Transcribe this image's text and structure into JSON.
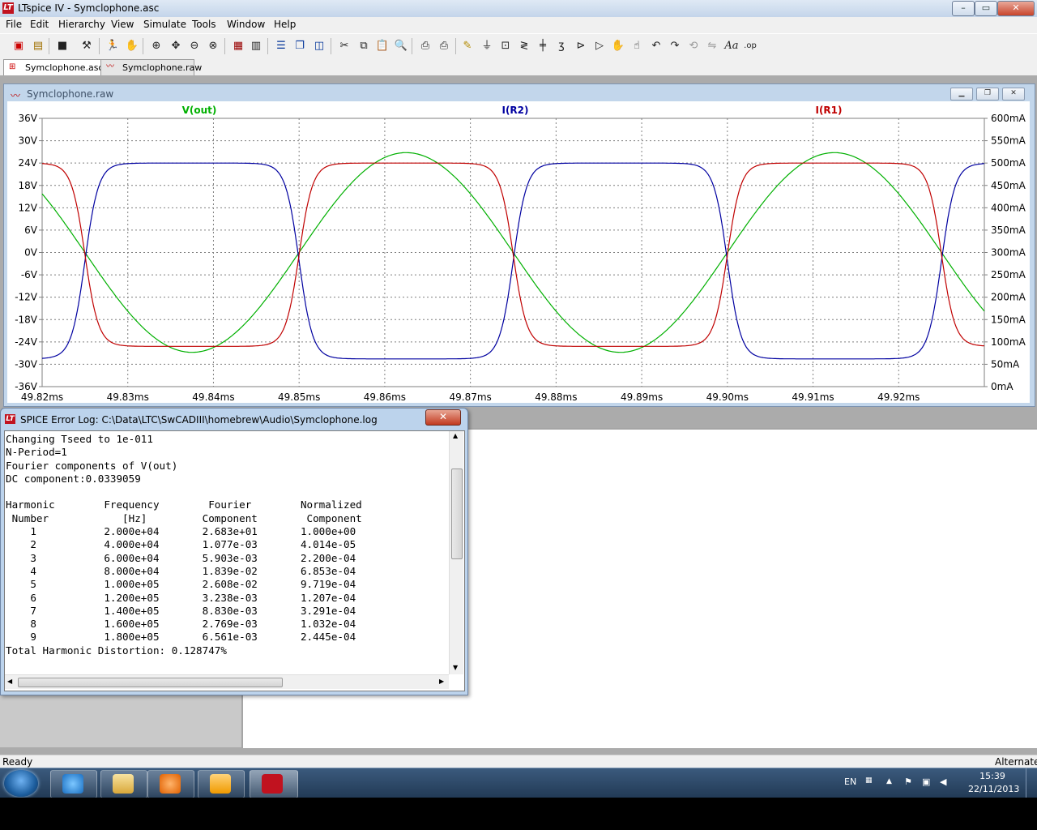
{
  "window": {
    "title": "LTspice IV - Symclophone.asc",
    "app_icon": "LT"
  },
  "menu": [
    "File",
    "Edit",
    "Hierarchy",
    "View",
    "Simulate",
    "Tools",
    "Window",
    "Help"
  ],
  "tabs": [
    {
      "label": "Symclophone.asc",
      "icon": "schematic-icon"
    },
    {
      "label": "Symclophone.raw",
      "icon": "waveform-icon"
    }
  ],
  "plot_window": {
    "title": "Symclophone.raw"
  },
  "chart_data": {
    "type": "line",
    "series": [
      {
        "name": "V(out)",
        "color": "#00b000",
        "axis": "left",
        "amplitude_V": 26.8,
        "phase_peak_ms": 49.8625,
        "shape": "sine"
      },
      {
        "name": "I(R2)",
        "color": "#0000a0",
        "axis": "right",
        "high_mA": 500,
        "low_mA": 62,
        "shape": "clipped-square",
        "high_centers_ms": [
          49.8375,
          49.8875,
          49.9375
        ],
        "low_centers_ms": [
          49.8125,
          49.8625,
          49.9125
        ]
      },
      {
        "name": "I(R1)",
        "color": "#c00000",
        "axis": "right",
        "high_mA": 500,
        "low_mA": 90,
        "shape": "clipped-square",
        "high_centers_ms": [
          49.8125,
          49.8625,
          49.9125
        ],
        "low_centers_ms": [
          49.8375,
          49.8875
        ]
      }
    ],
    "xlim": [
      49.82,
      49.93
    ],
    "x_ticks": [
      "49.82ms",
      "49.83ms",
      "49.84ms",
      "49.85ms",
      "49.86ms",
      "49.87ms",
      "49.88ms",
      "49.89ms",
      "49.90ms",
      "49.91ms",
      "49.92ms"
    ],
    "y_left": {
      "range": [
        -36,
        36
      ],
      "ticks": [
        "36V",
        "30V",
        "24V",
        "18V",
        "12V",
        "6V",
        "0V",
        "-6V",
        "-12V",
        "-18V",
        "-24V",
        "-30V",
        "-36V"
      ]
    },
    "y_right": {
      "range": [
        0,
        600
      ],
      "ticks": [
        "600mA",
        "550mA",
        "500mA",
        "450mA",
        "400mA",
        "350mA",
        "300mA",
        "250mA",
        "200mA",
        "150mA",
        "100mA",
        "50mA",
        "0mA"
      ]
    },
    "grid": true
  },
  "error_log": {
    "title": "SPICE Error Log: C:\\Data\\LTC\\SwCADIII\\homebrew\\Audio\\Symclophone.log",
    "close_label": "✕",
    "lines": [
      "Changing Tseed to 1e-011",
      "N-Period=1",
      "Fourier components of V(out)",
      "DC component:0.0339059",
      "",
      "Harmonic        Frequency        Fourier        Normalized",
      " Number            [Hz]         Component        Component",
      "    1           2.000e+04       2.683e+01       1.000e+00",
      "    2           4.000e+04       1.077e-03       4.014e-05",
      "    3           6.000e+04       5.903e-03       2.200e-04",
      "    4           8.000e+04       1.839e-02       6.853e-04",
      "    5           1.000e+05       2.608e-02       9.719e-04",
      "    6           1.200e+05       3.238e-03       1.207e-04",
      "    7           1.400e+05       8.830e-03       3.291e-04",
      "    8           1.600e+05       2.769e-03       1.032e-04",
      "    9           1.800e+05       6.561e-03       2.445e-04",
      "Total Harmonic Distortion: 0.128747%"
    ]
  },
  "status": {
    "left": "Ready",
    "right": "Alternate"
  },
  "tray": {
    "lang": "EN",
    "time": "15:39",
    "date": "22/11/2013"
  }
}
